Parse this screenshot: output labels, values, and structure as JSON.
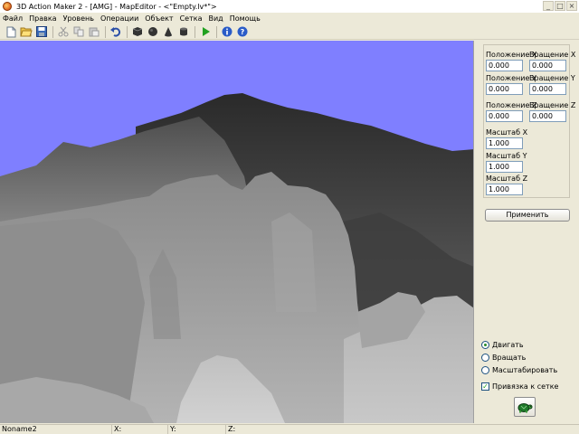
{
  "window": {
    "title": "3D Action Maker 2 - [AMG] - MapEditor - <\"Empty.lv*\">",
    "controls": [
      "_",
      "□",
      "×"
    ]
  },
  "menu": [
    "Файл",
    "Правка",
    "Уровень",
    "Операции",
    "Объект",
    "Сетка",
    "Вид",
    "Помощь"
  ],
  "toolbar": {
    "icons": [
      "new-file-icon",
      "open-folder-icon",
      "save-icon",
      "cut-icon",
      "copy-icon",
      "paste-icon",
      "undo-icon",
      "cube-icon",
      "sphere-icon",
      "cone-icon",
      "cylinder-icon",
      "play-icon",
      "info-icon",
      "help-icon"
    ]
  },
  "colors": {
    "sky": "#7f7fff",
    "panel": "#ece9d8",
    "accent": "#2a8c2a"
  },
  "panel": {
    "pos_x_label": "Положение X",
    "pos_x_value": "0.000",
    "rot_x_label": "Вращение X",
    "rot_x_value": "0.000",
    "pos_y_label": "Положение Y",
    "pos_y_value": "0.000",
    "rot_y_label": "Вращение Y",
    "rot_y_value": "0.000",
    "pos_z_label": "Положение Z",
    "pos_z_value": "0.000",
    "rot_z_label": "Вращение Z",
    "rot_z_value": "0.000",
    "scale_x_label": "Масштаб X",
    "scale_x_value": "1.000",
    "scale_y_label": "Масштаб Y",
    "scale_y_value": "1.000",
    "scale_z_label": "Масштаб Z",
    "scale_z_value": "1.000",
    "apply_label": "Применить",
    "modes": [
      {
        "label": "Двигать",
        "selected": true
      },
      {
        "label": "Вращать",
        "selected": false
      },
      {
        "label": "Масштабировать",
        "selected": false
      }
    ],
    "snap_label": "Привязка к сетке",
    "snap_checked": true
  },
  "status": {
    "name": "Noname2",
    "x_label": "X:",
    "y_label": "Y:",
    "z_label": "Z:"
  }
}
